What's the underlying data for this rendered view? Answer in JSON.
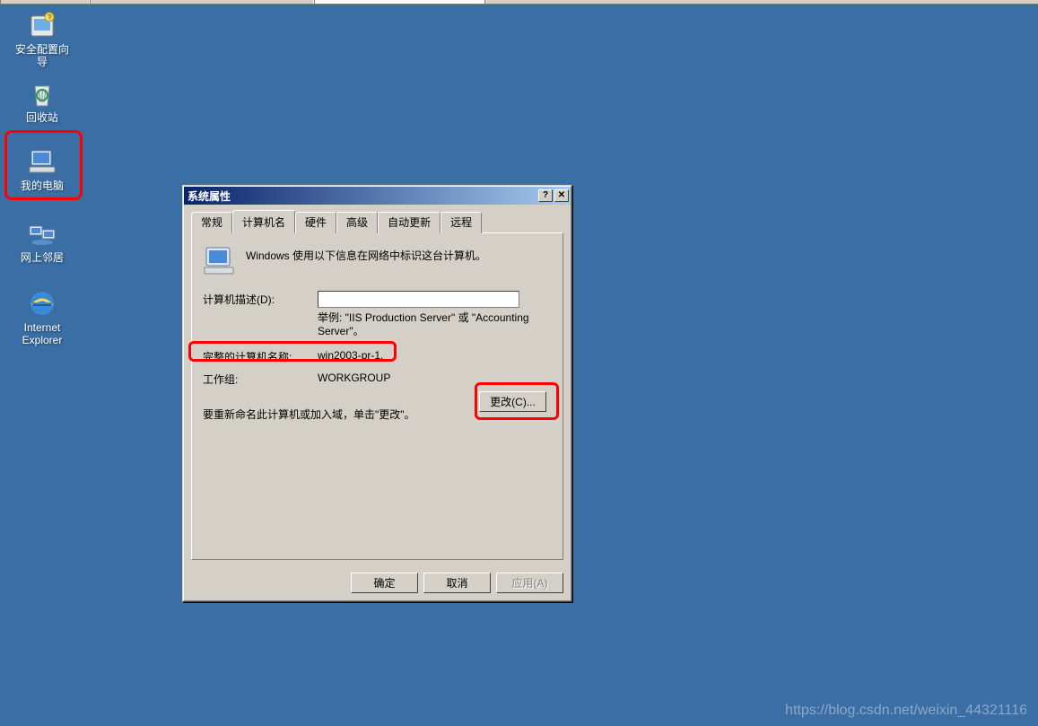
{
  "desktop": {
    "icons": [
      {
        "label": "安全配置向\n导"
      },
      {
        "label": "回收站"
      },
      {
        "label": "我的电脑"
      },
      {
        "label": "网上邻居"
      },
      {
        "label": "Internet\nExplorer"
      }
    ]
  },
  "dialog": {
    "title": "系统属性",
    "help_btn": "?",
    "close_btn": "✕",
    "tabs": [
      "常规",
      "计算机名",
      "硬件",
      "高级",
      "自动更新",
      "远程"
    ],
    "active_tab_index": 1,
    "intro_text": "Windows 使用以下信息在网络中标识这台计算机。",
    "description_label": "计算机描述(D):",
    "description_value": "",
    "example_text": "举例: \"IIS Production Server\" 或 \"Accounting Server\"。",
    "fullname_label": "完整的计算机名称:",
    "fullname_value": "win2003-pr-1.",
    "workgroup_label": "工作组:",
    "workgroup_value": "WORKGROUP",
    "rename_text": "要重新命名此计算机或加入域，单击\"更改\"。",
    "change_button": "更改(C)...",
    "ok_button": "确定",
    "cancel_button": "取消",
    "apply_button": "应用(A)"
  },
  "watermark": "https://blog.csdn.net/weixin_44321116"
}
